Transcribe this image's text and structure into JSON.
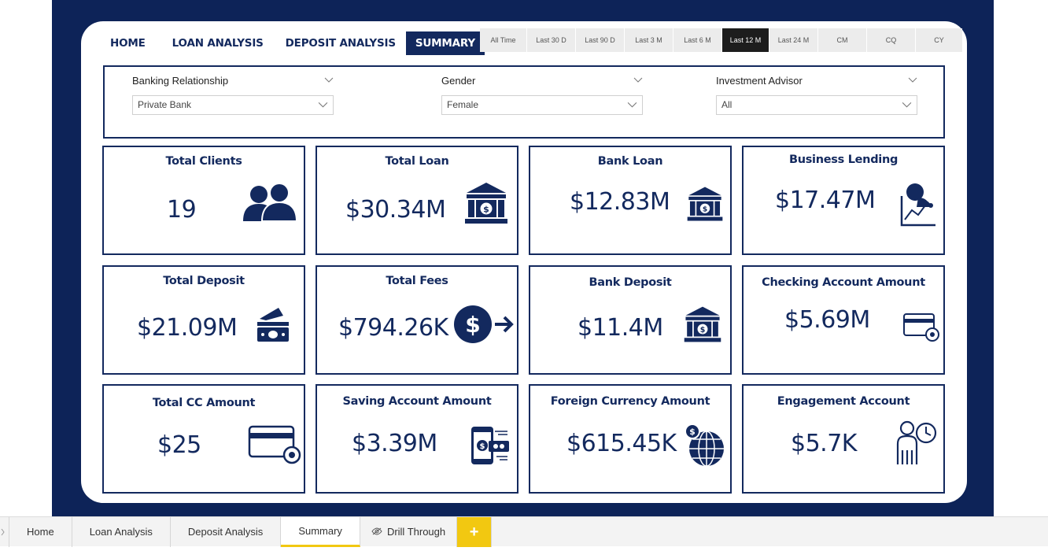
{
  "nav": {
    "items": [
      "HOME",
      "LOAN ANALYSIS",
      "DEPOSIT ANALYSIS",
      "SUMMARY"
    ],
    "active": "SUMMARY"
  },
  "timebar": {
    "items": [
      "All Time",
      "Last 30 D",
      "Last 90 D",
      "Last 3 M",
      "Last 6 M",
      "Last 12 M",
      "Last 24 M",
      "CM",
      "CQ",
      "CY"
    ],
    "active": "Last 12 M"
  },
  "filters": {
    "banking": {
      "label": "Banking Relationship",
      "value": "Private Bank"
    },
    "gender": {
      "label": "Gender",
      "value": "Female"
    },
    "advisor": {
      "label": "Investment Advisor",
      "value": "All"
    }
  },
  "kpis": {
    "total_clients": {
      "title": "Total Clients",
      "value": "19",
      "icon": "clients-icon"
    },
    "total_loan": {
      "title": "Total Loan",
      "value": "$30.34M",
      "icon": "bank-icon"
    },
    "bank_loan": {
      "title": "Bank Loan",
      "value": "$12.83M",
      "icon": "bank-icon"
    },
    "business_lending": {
      "title": "Business Lending",
      "value": "$17.47M",
      "icon": "business-growth-icon"
    },
    "total_deposit": {
      "title": "Total Deposit",
      "value": "$21.09M",
      "icon": "cash-deposit-icon"
    },
    "total_fees": {
      "title": "Total Fees",
      "value": "$794.26K",
      "icon": "dollar-transfer-icon"
    },
    "bank_deposit": {
      "title": "Bank Deposit",
      "value": "$11.4M",
      "icon": "bank-icon"
    },
    "checking_account": {
      "title": "Checking Account Amount",
      "value": "$5.69M",
      "icon": "card-settings-icon"
    },
    "total_cc": {
      "title": "Total CC Amount",
      "value": "$25",
      "icon": "card-settings-icon"
    },
    "saving_account": {
      "title": "Saving Account Amount",
      "value": "$3.39M",
      "icon": "mobile-payment-icon"
    },
    "foreign_currency": {
      "title": "Foreign Currency Amount",
      "value": "$615.45K",
      "icon": "globe-dollar-icon"
    },
    "engagement_account": {
      "title": "Engagement Account",
      "value": "$5.7K",
      "icon": "person-clock-icon"
    }
  },
  "tabs": {
    "items": [
      "Home",
      "Loan Analysis",
      "Deposit Analysis",
      "Summary",
      "Drill Through"
    ],
    "active": "Summary",
    "add_label": "+"
  },
  "colors": {
    "navy": "#0d2358",
    "accent": "#f2c811"
  }
}
